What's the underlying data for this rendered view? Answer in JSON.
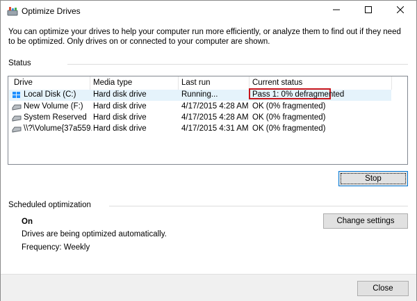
{
  "window": {
    "title": "Optimize Drives"
  },
  "intro": {
    "text": "You can optimize your drives to help your computer run more efficiently, or analyze them to find out if they need to be optimized. Only drives on or connected to your computer are shown."
  },
  "status": {
    "label": "Status",
    "columns": [
      "Drive",
      "Media type",
      "Last run",
      "Current status"
    ],
    "rows": [
      {
        "drive": "Local Disk (C:)",
        "media": "Hard disk drive",
        "last_run": "Running...",
        "status": "Pass 1: 0% defragmented",
        "icon": "windows-drive-icon"
      },
      {
        "drive": "New Volume (F:)",
        "media": "Hard disk drive",
        "last_run": "4/17/2015 4:28 AM",
        "status": "OK (0% fragmented)",
        "icon": "drive-icon"
      },
      {
        "drive": "System Reserved",
        "media": "Hard disk drive",
        "last_run": "4/17/2015 4:28 AM",
        "status": "OK (0% fragmented)",
        "icon": "drive-icon"
      },
      {
        "drive": "\\\\?\\Volume{37a559...",
        "media": "Hard disk drive",
        "last_run": "4/17/2015 4:31 AM",
        "status": "OK (0% fragmented)",
        "icon": "drive-icon"
      }
    ],
    "stop_label": "Stop"
  },
  "scheduled": {
    "label": "Scheduled optimization",
    "state": "On",
    "description": "Drives are being optimized automatically.",
    "frequency": "Frequency: Weekly",
    "change_label": "Change settings"
  },
  "footer": {
    "close_label": "Close"
  },
  "colors": {
    "highlight_border": "#c8161d",
    "selected_row": "#e5f3fb",
    "focus_border": "#0078d7"
  }
}
